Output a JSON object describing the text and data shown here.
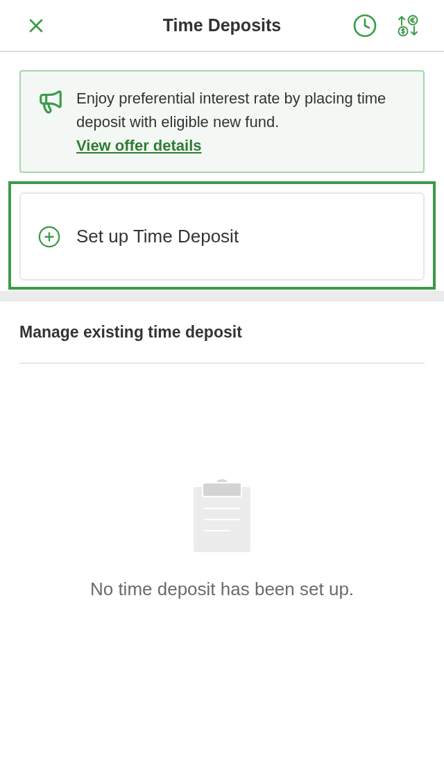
{
  "header": {
    "title": "Time Deposits"
  },
  "banner": {
    "text": "Enjoy preferential interest rate by placing time deposit with eligible new fund.",
    "link": "View offer details"
  },
  "setup_action": {
    "label": "Set up Time Deposit",
    "highlighted": true
  },
  "existing_section": {
    "heading": "Manage existing time deposit"
  },
  "empty_state": {
    "message": "No time deposit has been set up."
  }
}
